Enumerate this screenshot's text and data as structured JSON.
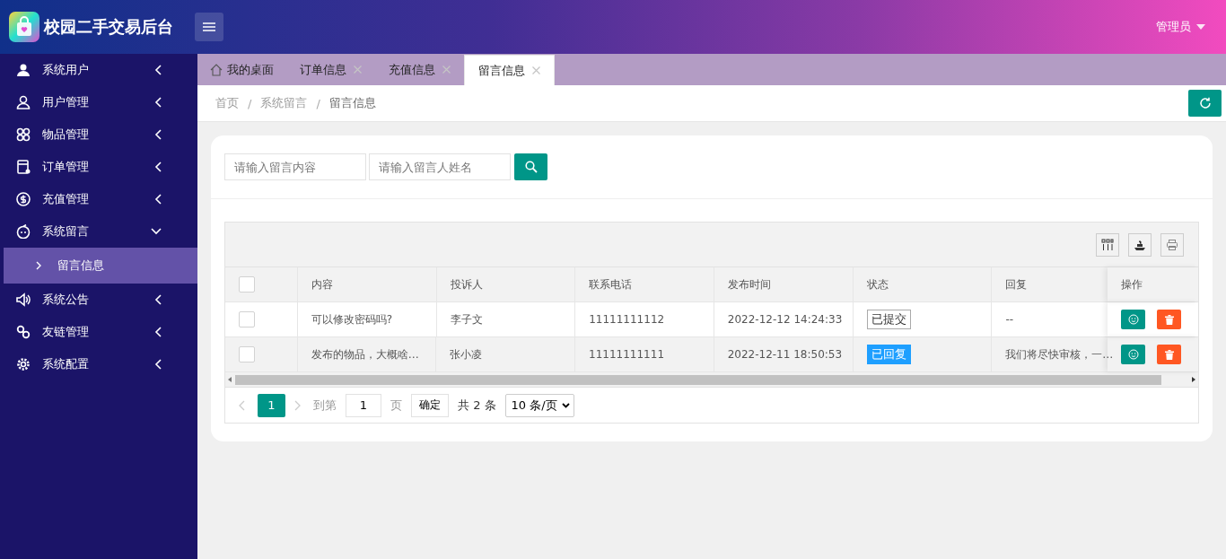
{
  "header": {
    "title": "校园二手交易后台",
    "user": "管理员"
  },
  "sidebar": {
    "items": [
      {
        "label": "系统用户",
        "expanded": false
      },
      {
        "label": "用户管理",
        "expanded": false
      },
      {
        "label": "物品管理",
        "expanded": false
      },
      {
        "label": "订单管理",
        "expanded": false
      },
      {
        "label": "充值管理",
        "expanded": false
      },
      {
        "label": "系统留言",
        "expanded": true,
        "children": [
          {
            "label": "留言信息",
            "selected": true
          }
        ]
      },
      {
        "label": "系统公告",
        "expanded": false
      },
      {
        "label": "友链管理",
        "expanded": false
      },
      {
        "label": "系统配置",
        "expanded": false
      }
    ]
  },
  "tabs": [
    {
      "label": "我的桌面",
      "selected": false,
      "closable": false
    },
    {
      "label": "订单信息",
      "selected": false,
      "closable": true
    },
    {
      "label": "充值信息",
      "selected": false,
      "closable": true
    },
    {
      "label": "留言信息",
      "selected": true,
      "closable": true
    }
  ],
  "breadcrumb": {
    "items": [
      "首页",
      "系统留言",
      "留言信息"
    ],
    "separator": "/"
  },
  "search": {
    "fields": [
      {
        "placeholder": "请输入留言内容"
      },
      {
        "placeholder": "请输入留言人姓名"
      }
    ]
  },
  "table": {
    "columns": [
      "内容",
      "投诉人",
      "联系电话",
      "发布时间",
      "状态",
      "回复",
      "操作"
    ],
    "header_checked": false,
    "rows": [
      {
        "checked": false,
        "highlighted": false,
        "content": "可以修改密码吗?",
        "person": "李子文",
        "phone": "11111111112",
        "time": "2022-12-12 14:24:33",
        "status": {
          "label": "已提交",
          "kind": "submitted"
        },
        "reply": "--"
      },
      {
        "checked": false,
        "highlighted": true,
        "content": "发布的物品，大概啥…",
        "person": "张小凌",
        "phone": "11111111111",
        "time": "2022-12-11 18:50:53",
        "status": {
          "label": "已回复",
          "kind": "replied"
        },
        "reply": "我们将尽快审核，一…"
      }
    ]
  },
  "pagination": {
    "pages": [
      {
        "label": "1",
        "selected": true
      }
    ],
    "goto_label": "到第",
    "goto_value": "1",
    "page_unit": "页",
    "confirm": "确定",
    "total": "共 2 条",
    "page_size": "10 条/页"
  }
}
